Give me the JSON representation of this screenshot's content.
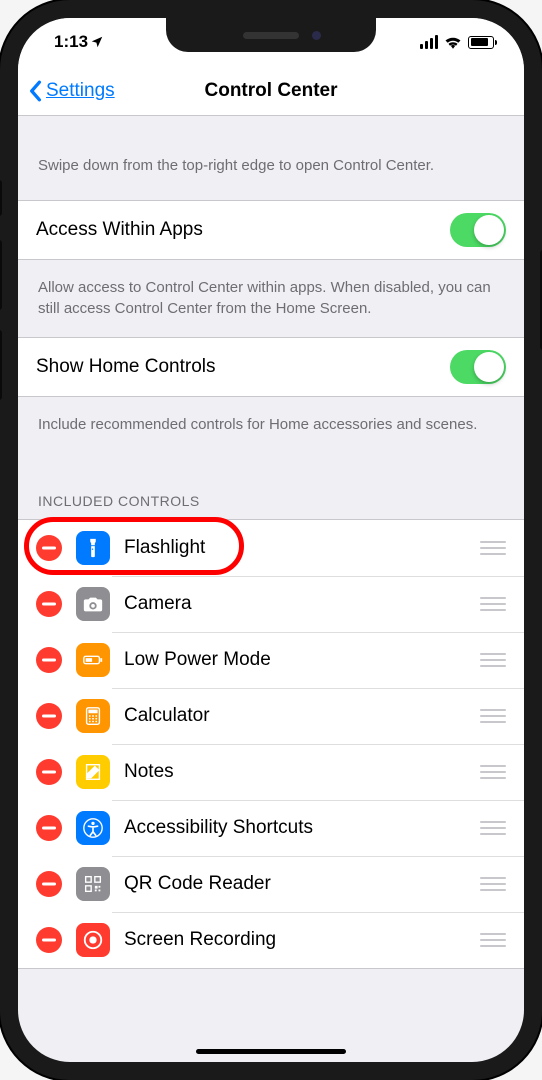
{
  "status": {
    "time": "1:13"
  },
  "nav": {
    "back": "Settings",
    "title": "Control Center"
  },
  "descr_top": "Swipe down from the top-right edge to open Control Center.",
  "toggles": [
    {
      "label": "Access Within Apps",
      "on": true
    },
    {
      "label": "Show Home Controls",
      "on": true
    }
  ],
  "descr_access": "Allow access to Control Center within apps. When disabled, you can still access Control Center from the Home Screen.",
  "descr_home": "Include recommended controls for Home accessories and scenes.",
  "section_header": "INCLUDED CONTROLS",
  "items": [
    {
      "label": "Flashlight",
      "icon": "flashlight",
      "color": "#007aff"
    },
    {
      "label": "Camera",
      "icon": "camera",
      "color": "#8e8e93"
    },
    {
      "label": "Low Power Mode",
      "icon": "battery",
      "color": "#ff9500"
    },
    {
      "label": "Calculator",
      "icon": "calculator",
      "color": "#ff9500"
    },
    {
      "label": "Notes",
      "icon": "notes",
      "color": "#ffcc00"
    },
    {
      "label": "Accessibility Shortcuts",
      "icon": "accessibility",
      "color": "#007aff"
    },
    {
      "label": "QR Code Reader",
      "icon": "qrcode",
      "color": "#8e8e93"
    },
    {
      "label": "Screen Recording",
      "icon": "record",
      "color": "#ff3b30"
    }
  ],
  "highlight_index": 0
}
